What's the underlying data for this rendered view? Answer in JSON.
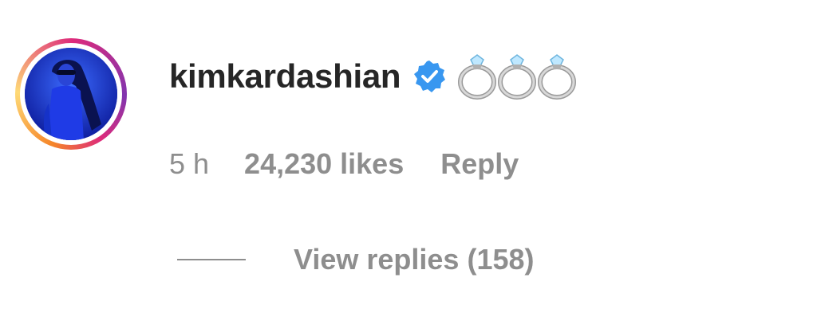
{
  "comment": {
    "username": "kimkardashian",
    "verified_icon": "verified-badge-icon",
    "text": "💍💍💍",
    "ring_icons": [
      "ring-icon",
      "ring-icon",
      "ring-icon"
    ],
    "time": "5 h",
    "likes": "24,230 likes",
    "reply_label": "Reply",
    "view_replies_label": "View replies (158)"
  },
  "colors": {
    "username": "#262626",
    "meta": "#8e8e8e",
    "verified": "#3897f0",
    "avatar_bg": "#1b2fd8"
  }
}
